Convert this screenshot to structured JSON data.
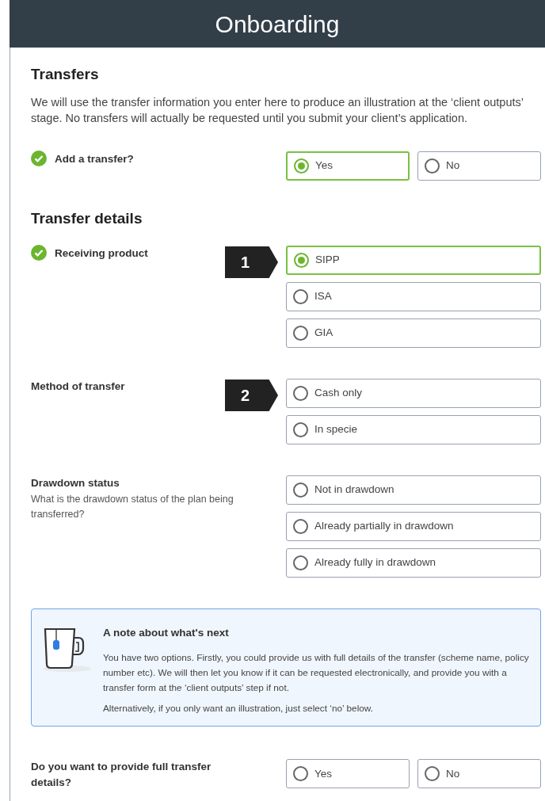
{
  "header": {
    "title": "Onboarding"
  },
  "sections": [
    {
      "kind": "heading",
      "text": "Transfers"
    },
    {
      "kind": "paragraph",
      "text": "We will use the transfer information you enter here to produce an illustration at the ‘client outputs’ stage. No transfers will actually be requested until you submit your client’s application."
    },
    {
      "kind": "inline_question",
      "label": "Add a transfer?",
      "completed": true,
      "options": [
        {
          "label": "Yes",
          "selected": true
        },
        {
          "label": "No",
          "selected": false
        }
      ]
    },
    {
      "kind": "heading",
      "text": "Transfer details"
    },
    {
      "kind": "question",
      "label": "Receiving product",
      "completed": true,
      "callout": "1",
      "options": [
        {
          "label": "SIPP",
          "selected": true
        },
        {
          "label": "ISA",
          "selected": false
        },
        {
          "label": "GIA",
          "selected": false
        }
      ]
    },
    {
      "kind": "question",
      "label": "Method of transfer",
      "completed": false,
      "callout": "2",
      "options": [
        {
          "label": "Cash only",
          "selected": false
        },
        {
          "label": "In specie",
          "selected": false
        }
      ]
    },
    {
      "kind": "question",
      "label": "Drawdown status",
      "hint": "What is the drawdown status of the plan being transferred?",
      "completed": false,
      "options": [
        {
          "label": "Not in drawdown",
          "selected": false
        },
        {
          "label": "Already partially in drawdown",
          "selected": false
        },
        {
          "label": "Already fully in drawdown",
          "selected": false
        }
      ]
    },
    {
      "kind": "note",
      "title": "A note about what's next",
      "paragraphs": [
        "You have two options. Firstly, you could provide us with full details of the transfer (scheme name, policy number etc). We will then let you know if it can be requested electronically, and provide you with a transfer form at the ‘client outputs’ step if not.",
        "Alternatively, if you only want an illustration, just select ‘no’ below."
      ]
    },
    {
      "kind": "inline_question",
      "label": "Do you want to provide full transfer details?",
      "completed": false,
      "options": [
        {
          "label": "Yes",
          "selected": false
        },
        {
          "label": "No",
          "selected": false
        }
      ]
    }
  ]
}
